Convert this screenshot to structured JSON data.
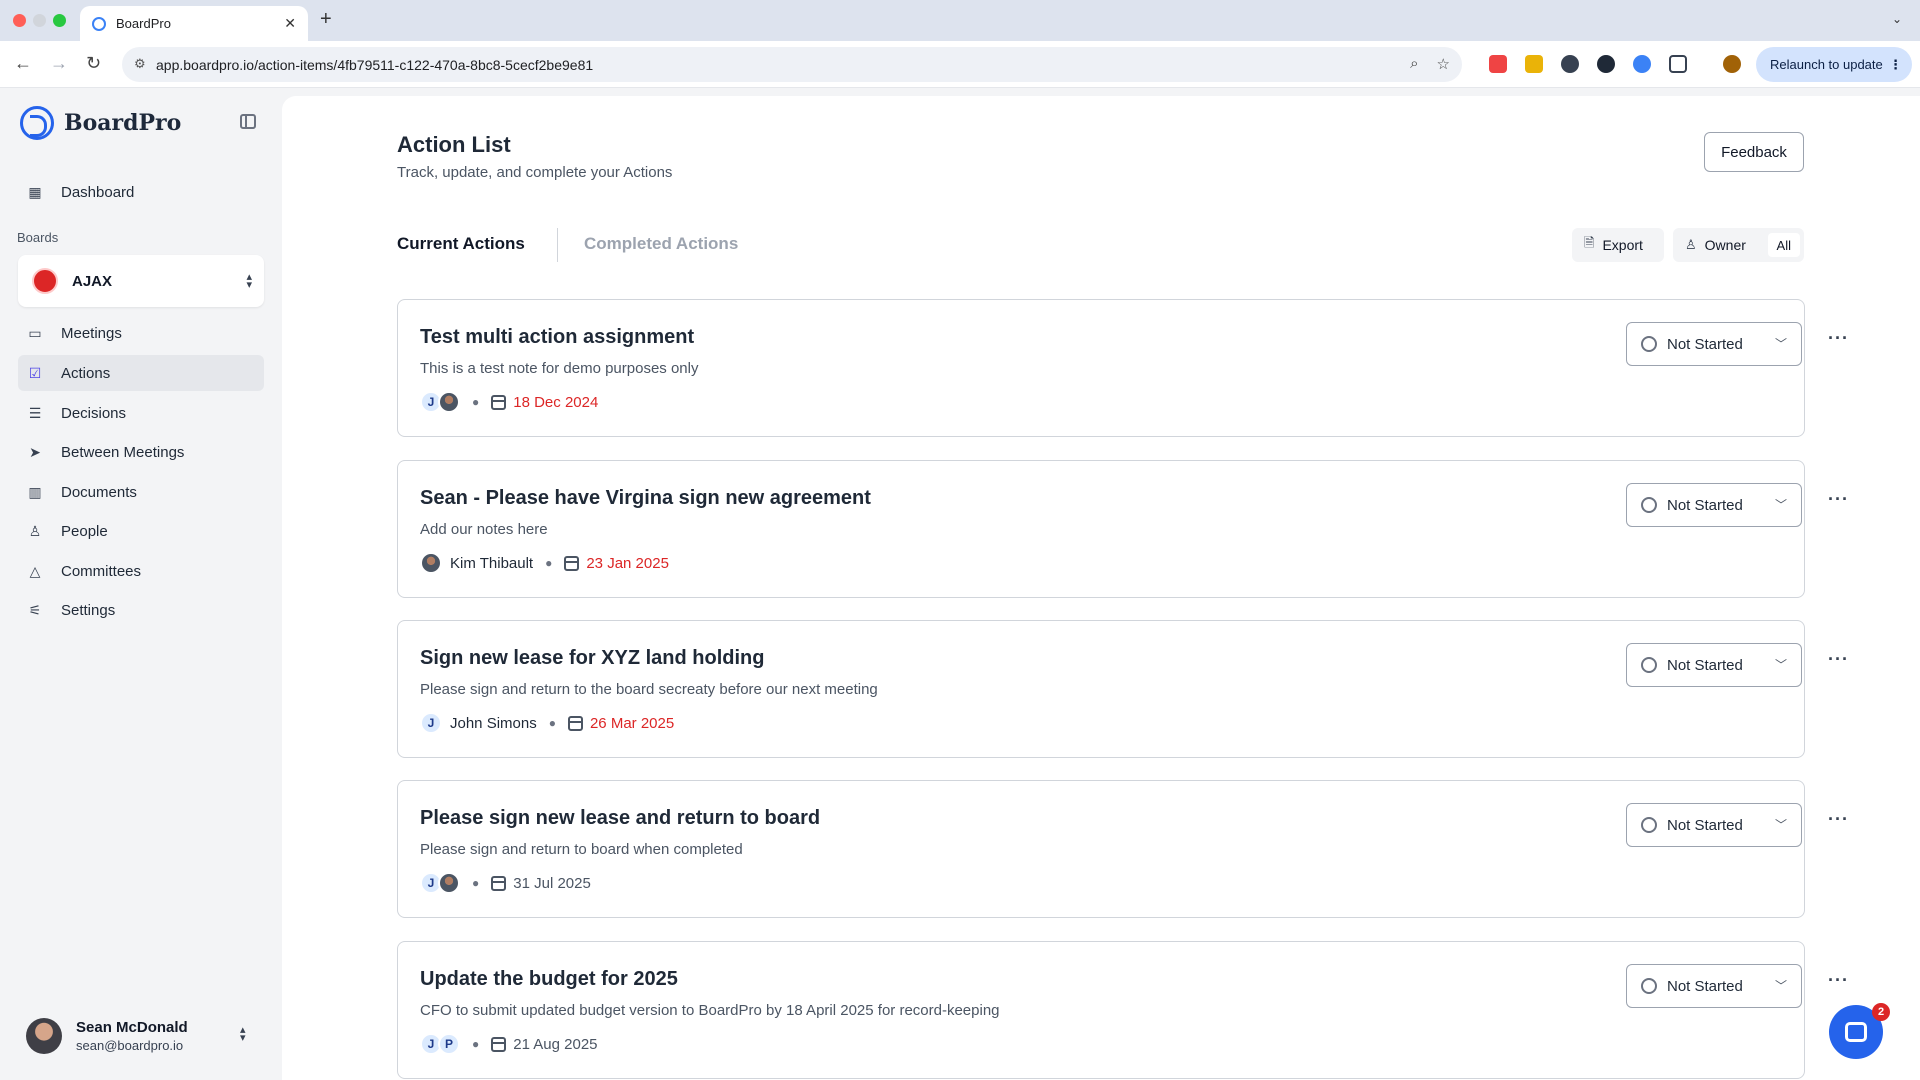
{
  "browser": {
    "tab_title": "BoardPro",
    "url": "app.boardpro.io/action-items/4fb79511-c122-470a-8bc8-5cecf2be9e81",
    "relaunch_label": "Relaunch to update"
  },
  "sidebar": {
    "logo_text": "BoardPro",
    "boards_label": "Boards",
    "board_name": "AJAX",
    "items": [
      {
        "label": "Dashboard",
        "icon": "grid-icon"
      },
      {
        "label": "Meetings",
        "icon": "calendar-icon"
      },
      {
        "label": "Actions",
        "icon": "clipboard-check-icon",
        "active": true
      },
      {
        "label": "Decisions",
        "icon": "list-check-icon"
      },
      {
        "label": "Between Meetings",
        "icon": "send-icon"
      },
      {
        "label": "Documents",
        "icon": "books-icon"
      },
      {
        "label": "People",
        "icon": "person-icon"
      },
      {
        "label": "Committees",
        "icon": "tent-icon"
      },
      {
        "label": "Settings",
        "icon": "sliders-icon"
      }
    ],
    "user": {
      "name": "Sean McDonald",
      "email": "sean@boardpro.io"
    }
  },
  "main": {
    "title": "Action List",
    "subtitle": "Track, update, and complete your Actions",
    "feedback_label": "Feedback",
    "tabs": [
      {
        "label": "Current Actions",
        "active": true
      },
      {
        "label": "Completed Actions",
        "active": false
      }
    ],
    "export_label": "Export",
    "owner_label": "Owner",
    "owner_value": "All",
    "actions": [
      {
        "title": "Test multi action assignment",
        "note": "This is a test note for demo purposes only",
        "owner": "",
        "date": "18 Dec 2024",
        "status": "Not Started"
      },
      {
        "title": "Sean - Please have Virgina sign new agreement",
        "note": "Add our notes here",
        "owner": "Kim Thibault",
        "date": "23 Jan 2025",
        "status": "Not Started"
      },
      {
        "title": "Sign new lease for XYZ land holding",
        "note": "Please sign and return to the board secreaty before our next meeting",
        "owner": "John Simons",
        "date": "26 Mar 2025",
        "status": "Not Started"
      },
      {
        "title": "Please sign new lease and return to board",
        "note": "Please sign and return to board when completed",
        "owner": "",
        "date": "31 Jul 2025",
        "status": "Not Started"
      },
      {
        "title": "Update the budget for 2025",
        "note": "CFO to submit updated budget version to BoardPro by 18 April 2025 for record-keeping",
        "owner": "",
        "date": "21 Aug 2025",
        "status": "Not Started"
      }
    ],
    "avatar_initials": {
      "j": "J",
      "p": "P"
    }
  },
  "chat": {
    "badge_count": "2"
  },
  "colors": {
    "accent": "#2563eb",
    "overdue": "#dc2626",
    "sidebar_bg": "#f3f4f6"
  }
}
